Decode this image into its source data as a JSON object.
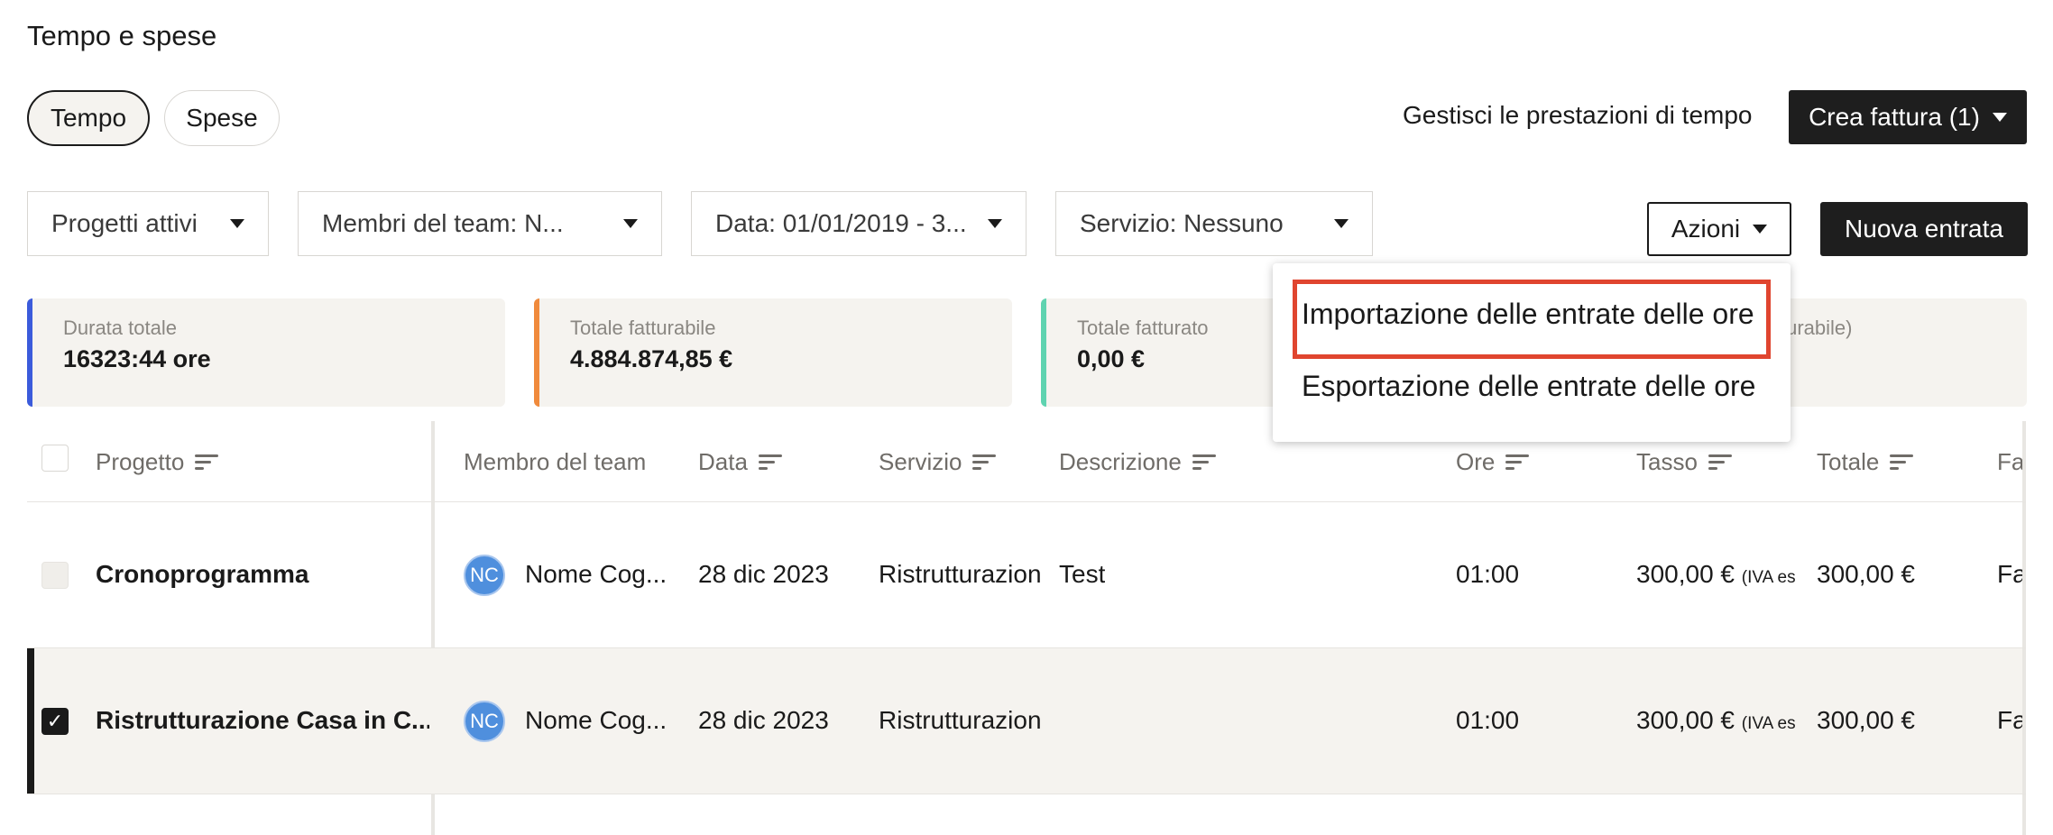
{
  "page": {
    "title": "Tempo e spese"
  },
  "tabs": [
    {
      "label": "Tempo",
      "active": true
    },
    {
      "label": "Spese",
      "active": false
    }
  ],
  "header_actions": {
    "manage_label": "Gestisci le prestazioni di tempo",
    "create_invoice_label": "Crea fattura (1)"
  },
  "filters": {
    "projects": "Progetti attivi",
    "team": "Membri del team: N...",
    "date": "Data: 01/01/2019 - 3...",
    "service": "Servizio: Nessuno"
  },
  "toolbar": {
    "actions_label": "Azioni",
    "new_entry_label": "Nuova entrata"
  },
  "actions_menu": {
    "items": [
      {
        "label": "Importazione delle entrate delle ore",
        "highlighted": true
      },
      {
        "label": "Esportazione delle entrate delle ore",
        "highlighted": false
      }
    ]
  },
  "summary": [
    {
      "label": "Durata totale",
      "value": "16323:44 ore",
      "color": "#3b5bdb"
    },
    {
      "label": "Totale fatturabile",
      "value": "4.884.874,85 €",
      "color": "#f08a3c"
    },
    {
      "label": "Totale fatturato",
      "value": "0,00 €",
      "color": "#5fd3b0"
    },
    {
      "label_partial": "turabile)"
    }
  ],
  "table": {
    "columns": {
      "project": "Progetto",
      "member": "Membro del team",
      "date": "Data",
      "service": "Servizio",
      "description": "Descrizione",
      "hours": "Ore",
      "rate": "Tasso",
      "total": "Totale",
      "invoice": "Fa"
    },
    "rows": [
      {
        "checked": false,
        "disabled": true,
        "project": "Cronoprogramma",
        "initials": "NC",
        "member": "Nome Cog...",
        "date": "28 dic 2023",
        "service": "Ristrutturazion",
        "description": "Test",
        "hours": "01:00",
        "rate": "300,00 €",
        "rate_note": "(IVA es",
        "total": "300,00 €",
        "invoice": "Fa"
      },
      {
        "checked": true,
        "disabled": false,
        "project": "Ristrutturazione Casa in C...",
        "initials": "NC",
        "member": "Nome Cog...",
        "date": "28 dic 2023",
        "service": "Ristrutturazion",
        "description": "",
        "hours": "01:00",
        "rate": "300,00 €",
        "rate_note": "(IVA es",
        "total": "300,00 €",
        "invoice": "Fa"
      }
    ]
  },
  "colors": {
    "highlight": "#e0452f",
    "selected_row_bar": "#1a1a1a",
    "avatar": "#4f8fdd"
  }
}
